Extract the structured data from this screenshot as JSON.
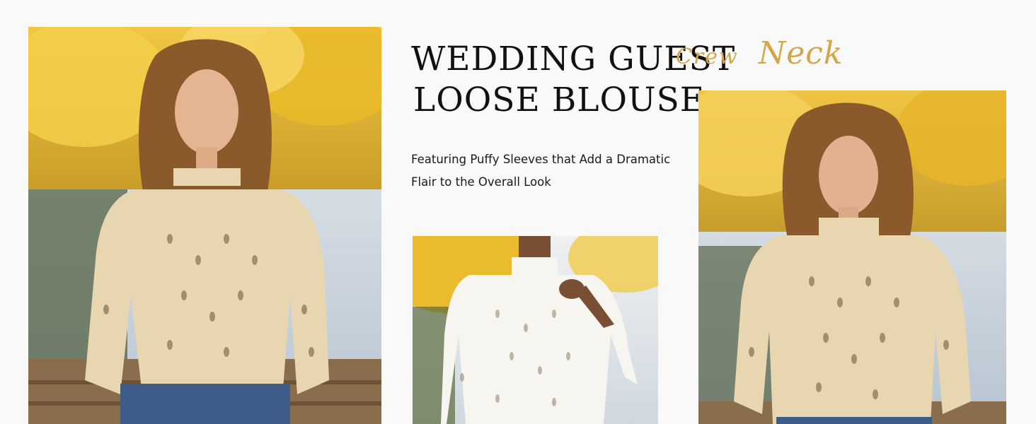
{
  "heading": {
    "line1": "WEDDING GUEST",
    "line2": "LOOSE BLOUSE"
  },
  "script_label": {
    "word1": "Crew",
    "word2": "Neck"
  },
  "subtitle": {
    "line1": "Featuring Puffy Sleeves that Add a Dramatic",
    "line2": "Flair to the Overall Look"
  },
  "colors": {
    "background": "#faf9fa",
    "heading": "#111111",
    "script_gold": "#d2a74a",
    "blouse_apricot": "#e8d6b0",
    "blouse_white": "#f7f5f0",
    "foliage_yellow": "#e6b82a",
    "denim": "#3d5c8a"
  }
}
